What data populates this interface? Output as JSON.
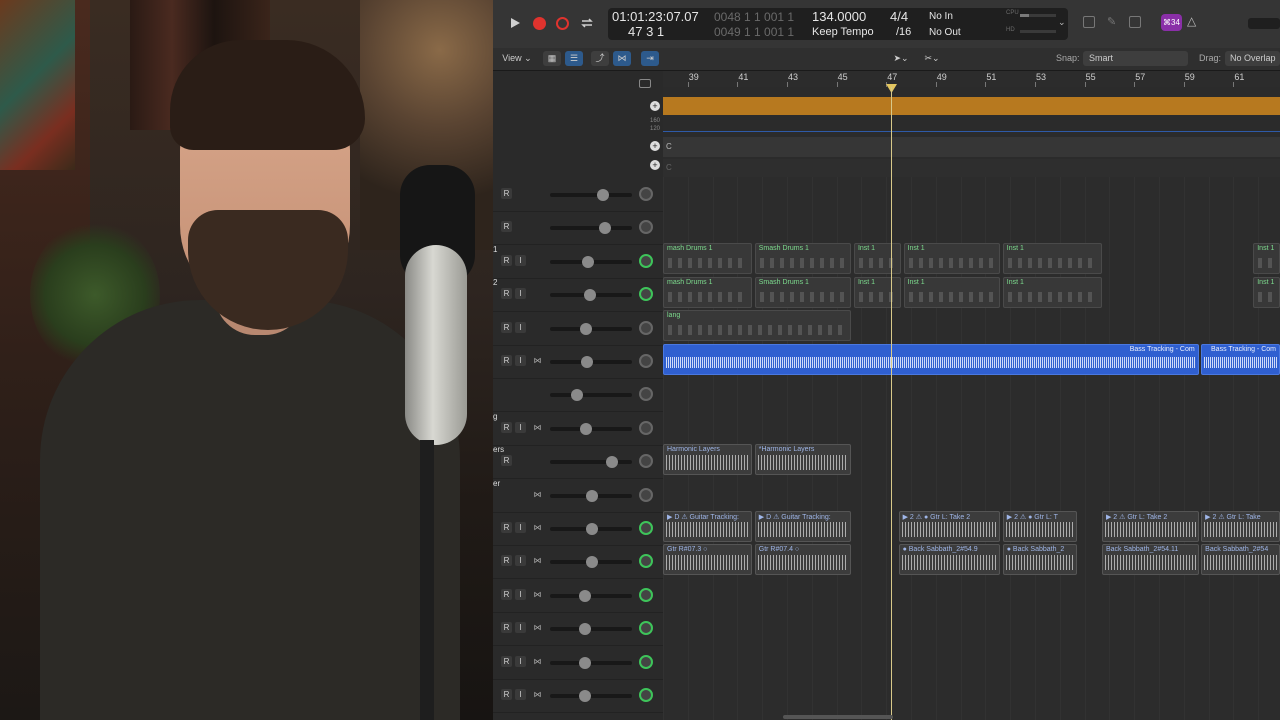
{
  "transport": {
    "position_smpte": "01:01:23:07.07",
    "position_bars": "47  3  1",
    "locator_top": "0048  1  1  001  1",
    "locator_bottom": "0049  1  1  001  1",
    "tempo": "134.0000",
    "tempo_mode": "Keep Tempo",
    "time_sig": "4/4",
    "division": "/16",
    "midi_in": "No In",
    "midi_out": "No Out",
    "cpu_label": "CPU",
    "hd_label": "HD",
    "badge": "⌘34"
  },
  "toolbar": {
    "view_label": "View",
    "snap_label": "Snap:",
    "snap_value": "Smart",
    "drag_label": "Drag:",
    "drag_value": "No Overlap"
  },
  "global_tracks": {
    "tempo_hi": "160",
    "tempo_lo": "120",
    "signature_key": "C",
    "transpose_key": "C"
  },
  "ruler": [
    "39",
    "41",
    "43",
    "45",
    "47",
    "49",
    "51",
    "53",
    "55",
    "57",
    "59",
    "61"
  ],
  "tracks": [
    {
      "name": "",
      "btns": [
        "R"
      ],
      "fader": 0.62,
      "pan_green": false
    },
    {
      "name": "",
      "btns": [
        "R"
      ],
      "fader": 0.65,
      "pan_green": false
    },
    {
      "name": "1",
      "btns": [
        "R",
        "I"
      ],
      "fader": 0.42,
      "pan_green": true
    },
    {
      "name": "2",
      "btns": [
        "R",
        "I"
      ],
      "fader": 0.45,
      "pan_green": true
    },
    {
      "name": "",
      "btns": [
        "R",
        "I"
      ],
      "fader": 0.4,
      "pan_green": false
    },
    {
      "name": "",
      "btns": [
        "R",
        "I",
        "ph"
      ],
      "fader": 0.41,
      "pan_green": false
    },
    {
      "name": "",
      "btns": [],
      "fader": 0.27,
      "pan_green": false
    },
    {
      "name": "g",
      "btns": [
        "R",
        "I",
        "ph"
      ],
      "fader": 0.4,
      "pan_green": false
    },
    {
      "name": "ers",
      "btns": [
        "R"
      ],
      "fader": 0.74,
      "pan_green": false
    },
    {
      "name": "er",
      "btns": [
        "ph"
      ],
      "fader": 0.48,
      "pan_green": false
    },
    {
      "name": "",
      "btns": [
        "R",
        "I",
        "ph"
      ],
      "fader": 0.48,
      "pan_green": true
    },
    {
      "name": "",
      "btns": [
        "R",
        "I",
        "ph"
      ],
      "fader": 0.48,
      "pan_green": true
    },
    {
      "name": "",
      "btns": [
        "R",
        "I",
        "ph"
      ],
      "fader": 0.38,
      "pan_green": true
    },
    {
      "name": "",
      "btns": [
        "R",
        "I",
        "ph"
      ],
      "fader": 0.38,
      "pan_green": true
    },
    {
      "name": "",
      "btns": [
        "R",
        "I",
        "ph"
      ],
      "fader": 0.38,
      "pan_green": true
    },
    {
      "name": "",
      "btns": [
        "R",
        "I",
        "ph"
      ],
      "fader": 0.38,
      "pan_green": true
    }
  ],
  "regions": [
    {
      "row": 2,
      "kind": "midi",
      "start": 38.0,
      "end": 41.6,
      "label": "mash Drums 1"
    },
    {
      "row": 2,
      "kind": "midi",
      "start": 41.7,
      "end": 45.6,
      "label": "Smash Drums 1"
    },
    {
      "row": 2,
      "kind": "midi",
      "start": 45.7,
      "end": 47.6,
      "label": "Inst 1"
    },
    {
      "row": 2,
      "kind": "midi",
      "start": 47.7,
      "end": 51.6,
      "label": "Inst 1"
    },
    {
      "row": 2,
      "kind": "midi",
      "start": 51.7,
      "end": 55.7,
      "label": "Inst 1"
    },
    {
      "row": 2,
      "kind": "midi",
      "start": 61.8,
      "end": 63.0,
      "label": "Inst 1"
    },
    {
      "row": 3,
      "kind": "midi",
      "start": 38.0,
      "end": 41.6,
      "label": "mash Drums 1"
    },
    {
      "row": 3,
      "kind": "midi",
      "start": 41.7,
      "end": 45.6,
      "label": "Smash Drums 1"
    },
    {
      "row": 3,
      "kind": "midi",
      "start": 45.7,
      "end": 47.6,
      "label": "Inst 1"
    },
    {
      "row": 3,
      "kind": "midi",
      "start": 47.7,
      "end": 51.6,
      "label": "Inst 1"
    },
    {
      "row": 3,
      "kind": "midi",
      "start": 51.7,
      "end": 55.7,
      "label": "Inst 1"
    },
    {
      "row": 3,
      "kind": "midi",
      "start": 61.8,
      "end": 63.0,
      "label": "Inst 1"
    },
    {
      "row": 4,
      "kind": "midi",
      "start": 38.0,
      "end": 45.6,
      "label": "lang"
    },
    {
      "row": 5,
      "kind": "audio-blue",
      "start": 38.0,
      "end": 59.6,
      "label": "Bass Tracking - Com"
    },
    {
      "row": 5,
      "kind": "audio-blue",
      "start": 59.7,
      "end": 63.0,
      "label": "Bass Tracking - Com"
    },
    {
      "row": 8,
      "kind": "audio-gray",
      "start": 38.0,
      "end": 41.6,
      "label": "Harmonic Layers"
    },
    {
      "row": 8,
      "kind": "audio-gray",
      "start": 41.7,
      "end": 45.6,
      "label": "*Harmonic Layers"
    },
    {
      "row": 10,
      "kind": "audio-gray",
      "start": 38.0,
      "end": 41.6,
      "label": "▶ D ⚠ Guitar Tracking:"
    },
    {
      "row": 10,
      "kind": "audio-gray",
      "start": 41.7,
      "end": 45.6,
      "label": "▶ D ⚠ Guitar Tracking:"
    },
    {
      "row": 10,
      "kind": "audio-gray",
      "start": 47.5,
      "end": 51.6,
      "label": "▶ 2 ⚠ ● Gtr L: Take 2"
    },
    {
      "row": 10,
      "kind": "audio-gray",
      "start": 51.7,
      "end": 54.7,
      "label": "▶ 2 ⚠ ● Gtr L: T"
    },
    {
      "row": 10,
      "kind": "audio-gray",
      "start": 55.7,
      "end": 59.6,
      "label": "▶ 2 ⚠ Gtr L: Take 2"
    },
    {
      "row": 10,
      "kind": "audio-gray",
      "start": 59.7,
      "end": 63.0,
      "label": "▶ 2 ⚠ Gtr L: Take"
    },
    {
      "row": 11,
      "kind": "audio-gray",
      "start": 38.0,
      "end": 41.6,
      "label": "Gtr R#07.3 ○"
    },
    {
      "row": 11,
      "kind": "audio-gray",
      "start": 41.7,
      "end": 45.6,
      "label": "Gtr R#07.4 ○"
    },
    {
      "row": 11,
      "kind": "audio-gray",
      "start": 47.5,
      "end": 51.6,
      "label": "● Back Sabbath_2#54.9"
    },
    {
      "row": 11,
      "kind": "audio-gray",
      "start": 51.7,
      "end": 54.7,
      "label": "● Back Sabbath_2"
    },
    {
      "row": 11,
      "kind": "audio-gray",
      "start": 55.7,
      "end": 59.6,
      "label": "Back Sabbath_2#54.11"
    },
    {
      "row": 11,
      "kind": "audio-gray",
      "start": 59.7,
      "end": 63.0,
      "label": "Back Sabbath_2#54"
    }
  ],
  "colors": {
    "tempo_track": "#b7791f",
    "midi_label": "#7ddc8e",
    "audio_blue": "#2f5fd0",
    "pan_green": "#3ec45a",
    "record": "#e0332e"
  }
}
